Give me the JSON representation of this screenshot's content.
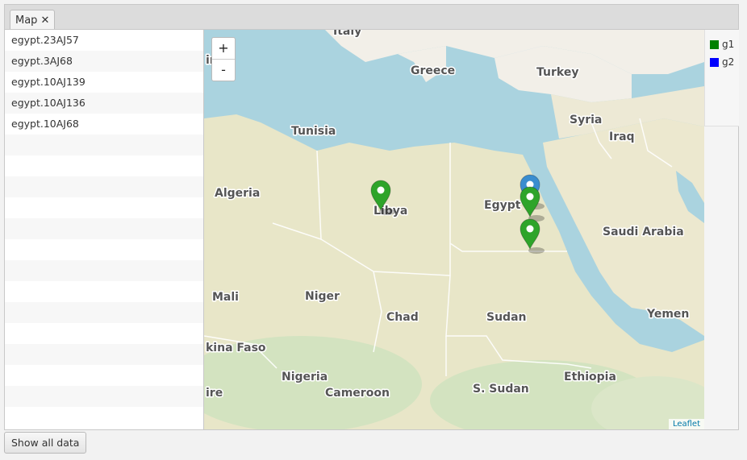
{
  "tabs": [
    {
      "label": "Map",
      "close": "✕"
    }
  ],
  "list": {
    "items": [
      "egypt.23AJ57",
      "egypt.3AJ68",
      "egypt.10AJ139",
      "egypt.10AJ136",
      "egypt.10AJ68"
    ],
    "empty_rows": 14
  },
  "map": {
    "zoom_in": "+",
    "zoom_out": "-",
    "attribution": "Leaflet",
    "labels": {
      "italy": "Italy",
      "greece": "Greece",
      "turkey": "Turkey",
      "tunisia": "Tunisia",
      "syria": "Syria",
      "iraq": "Iraq",
      "algeria": "Algeria",
      "libya": "Libya",
      "egypt": "Egypt",
      "saudi": "Saudi Arabia",
      "mali": "Mali",
      "niger": "Niger",
      "chad": "Chad",
      "sudan": "Sudan",
      "yemen": "Yemen",
      "burkina": "kina Faso",
      "nigeria": "Nigeria",
      "cameroon": "Cameroon",
      "ssudan": "S. Sudan",
      "ethiopia": "Ethiopia",
      "ire": "ire",
      "ir": "ir"
    },
    "markers": [
      {
        "group": "g1",
        "color": "#2ea42a"
      },
      {
        "group": "g2",
        "color": "#3a8dcf"
      },
      {
        "group": "g1",
        "color": "#2ea42a"
      },
      {
        "group": "g1",
        "color": "#2ea42a"
      }
    ]
  },
  "legend": [
    {
      "label": "g1",
      "color": "#008000"
    },
    {
      "label": "g2",
      "color": "#0000ff"
    }
  ],
  "footer": {
    "show_all_label": "Show all data"
  }
}
